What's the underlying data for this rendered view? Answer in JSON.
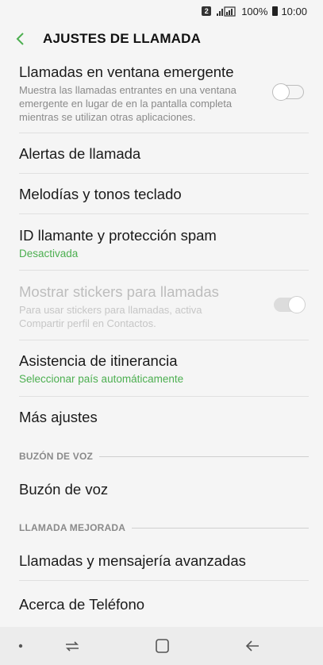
{
  "status_bar": {
    "sim_badge": "2",
    "signal": "ᴵᴵᴵ",
    "battery_pct": "100%",
    "time": "10:00"
  },
  "header": {
    "title": "AJUSTES DE LLAMADA",
    "back_icon": "chevron-left-icon",
    "accent_color": "#4caf50"
  },
  "items": {
    "popup": {
      "title": "Llamadas en ventana emergente",
      "desc": "Muestra las llamadas entrantes en una ventana emergente en lugar de en la pantalla completa mientras se utilizan otras aplicaciones.",
      "toggle": "off"
    },
    "alerts": {
      "title": "Alertas de llamada"
    },
    "ringtones": {
      "title": "Melodías y tonos teclado"
    },
    "caller_id": {
      "title": "ID llamante y protección spam",
      "sub": "Desactivada"
    },
    "stickers": {
      "title": "Mostrar stickers para llamadas",
      "desc": "Para usar stickers para llamadas, activa Compartir perfil en Contactos.",
      "toggle": "disabled"
    },
    "roaming": {
      "title": "Asistencia de itinerancia",
      "sub": "Seleccionar país automáticamente"
    },
    "more": {
      "title": "Más ajustes"
    }
  },
  "sections": {
    "voicemail": {
      "label": "BUZÓN DE VOZ",
      "item": "Buzón de voz"
    },
    "enhanced": {
      "label": "LLAMADA MEJORADA",
      "item": "Llamadas y mensajería avanzadas"
    }
  },
  "about": {
    "title": "Acerca de Teléfono"
  },
  "navbar": {
    "icons": [
      "dot-icon",
      "recent-apps-icon",
      "home-icon",
      "back-icon"
    ]
  }
}
